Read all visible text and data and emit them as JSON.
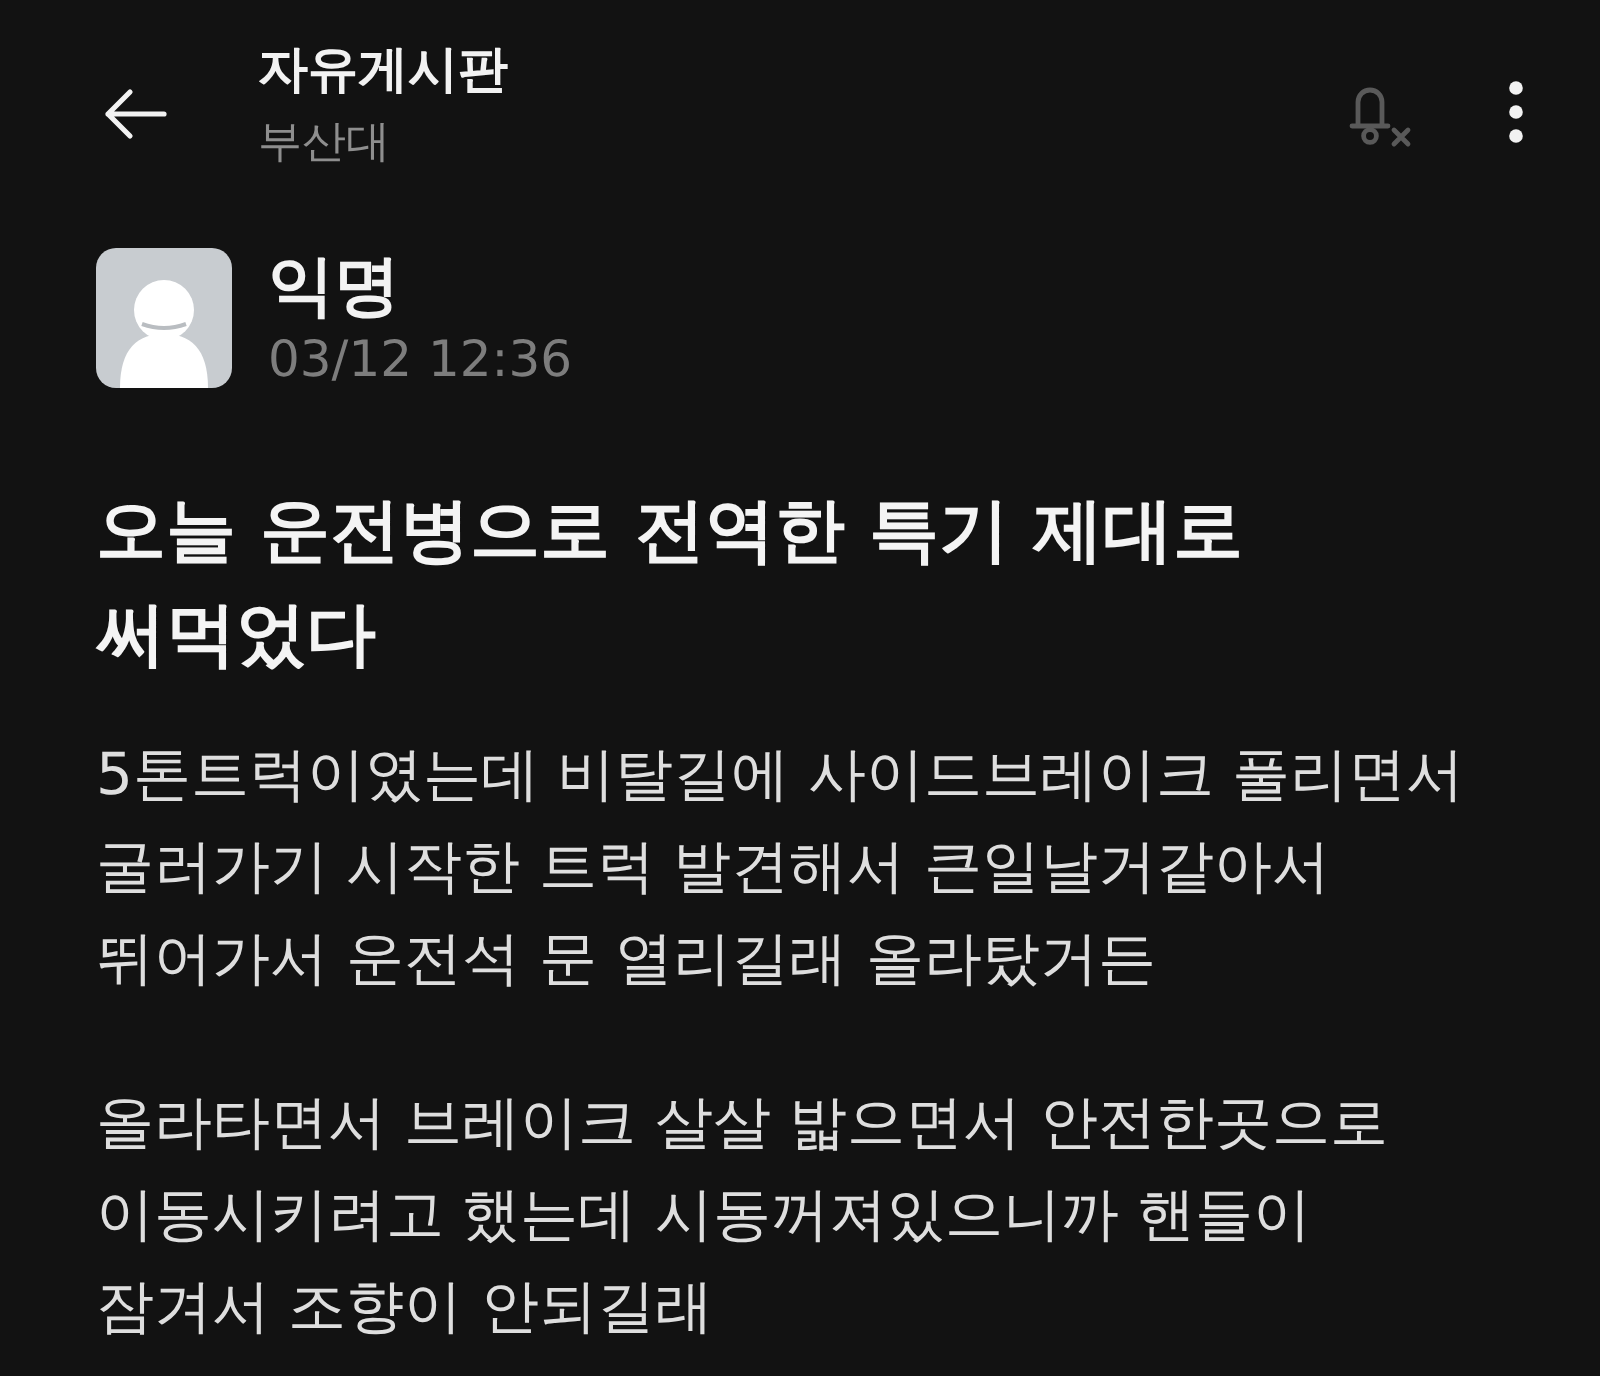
{
  "header": {
    "title": "자유게시판",
    "subtitle": "부산대",
    "notifications_on": false
  },
  "post": {
    "author": "익명",
    "time": "03/12 12:36",
    "title": "오늘 운전병으로 전역한 특기 제대로 써먹었다",
    "paragraphs": [
      "5톤트럭이였는데 비탈길에 사이드브레이크 풀리면서 굴러가기 시작한 트럭 발견해서 큰일날거같아서 뛰어가서 운전석 문 열리길래 올라탔거든",
      "올라타면서 브레이크 살살 밟으면서 안전한곳으로 이동시키려고 했는데 시동꺼져있으니까 핸들이 잠겨서 조향이 안되길래"
    ]
  }
}
